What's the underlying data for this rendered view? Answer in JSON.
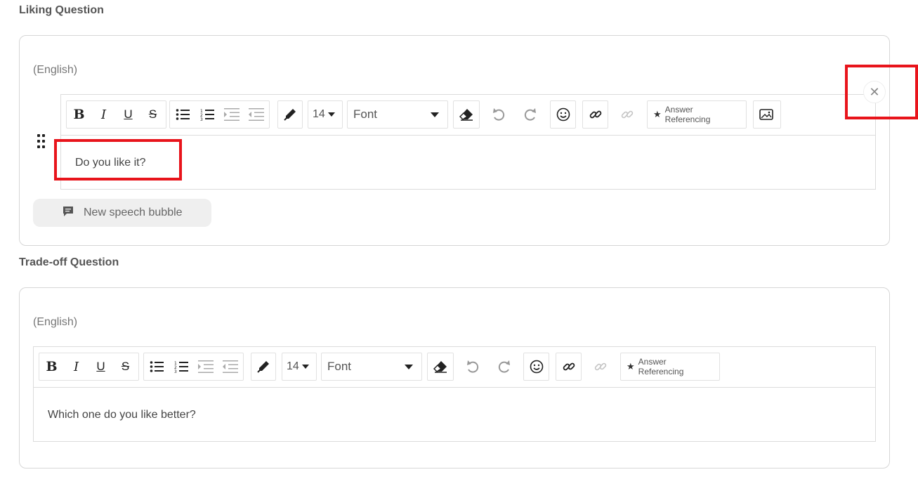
{
  "sections": [
    {
      "title": "Liking Question",
      "language": "(English)",
      "font_size": "14",
      "font_label": "Font",
      "answer_referencing": "Answer Referencing",
      "content": "Do you like it?",
      "speech_bubble_label": "New speech bubble"
    },
    {
      "title": "Trade-off Question",
      "language": "(English)",
      "font_size": "14",
      "font_label": "Font",
      "answer_referencing": "Answer Referencing",
      "content": "Which one do you like better?"
    }
  ],
  "toolbar_icons": [
    "bold-icon",
    "italic-icon",
    "underline-icon",
    "strikethrough-icon",
    "bullet-list-icon",
    "numbered-list-icon",
    "indent-icon",
    "outdent-icon",
    "text-color-icon",
    "font-size-select",
    "font-family-select",
    "eraser-icon",
    "undo-icon",
    "redo-icon",
    "emoji-icon",
    "link-icon",
    "unlink-icon",
    "star-icon",
    "image-icon",
    "close-icon",
    "drag-handle-icon",
    "speech-bubble-icon"
  ],
  "colors": {
    "highlight": "#e8141b",
    "border": "#d6d6d6",
    "button_bg": "#efefef"
  }
}
